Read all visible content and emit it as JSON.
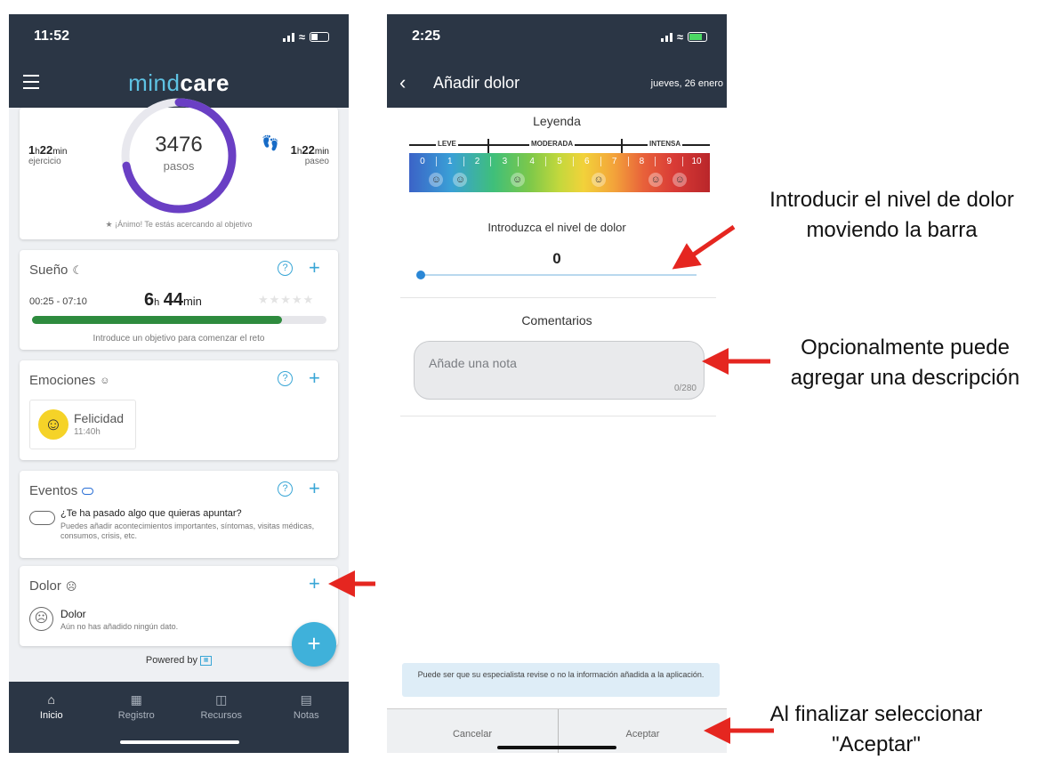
{
  "left": {
    "status_time": "11:52",
    "logo_thin": "mind",
    "logo_bold": "care",
    "activity": {
      "exercise_h": "1",
      "exercise_m": "22",
      "exercise_label": "ejercicio",
      "steps": "3476",
      "steps_label": "pasos",
      "walk_h": "1",
      "walk_m": "22",
      "walk_label": "paseo",
      "h_unit": "h",
      "min_unit": "min",
      "motivation": "¡Ánimo! Te estás acercando al objetivo",
      "progress": 0.72
    },
    "sleep": {
      "title": "Sueño",
      "range": "00:25 - 07:10",
      "hours": "6",
      "minutes": "44",
      "h_unit": "h",
      "min_unit": "min",
      "goal_text": "Introduce un objetivo para comenzar el reto",
      "progress": 0.85
    },
    "emotions": {
      "title": "Emociones",
      "emotion": "Felicidad",
      "time": "11:40h"
    },
    "events": {
      "title": "Eventos",
      "question": "¿Te ha pasado algo que quieras apuntar?",
      "description": "Puedes añadir acontecimientos importantes, síntomas, visitas médicas, consumos, crisis, etc."
    },
    "pain": {
      "title": "Dolor",
      "item_title": "Dolor",
      "empty": "Aún no has añadido ningún dato."
    },
    "powered_by": "Powered by",
    "nav": [
      {
        "label": "Inicio",
        "icon": "home-icon"
      },
      {
        "label": "Registro",
        "icon": "calendar-icon"
      },
      {
        "label": "Recursos",
        "icon": "book-icon"
      },
      {
        "label": "Notas",
        "icon": "document-icon"
      }
    ]
  },
  "right": {
    "status_time": "2:25",
    "title": "Añadir dolor",
    "date": "jueves, 26 enero",
    "legend_title": "Leyenda",
    "legend_labels": [
      "LEVE",
      "MODERADA",
      "INTENSA"
    ],
    "legend_numbers": [
      "0",
      "1",
      "2",
      "3",
      "4",
      "5",
      "6",
      "7",
      "8",
      "9",
      "10"
    ],
    "level_label": "Introduzca el nivel de dolor",
    "level_value": "0",
    "comments_label": "Comentarios",
    "note_placeholder": "Añade una nota",
    "char_count": "0/280",
    "notice": "Puede ser que su especialista revise o no la información añadida a la aplicación.",
    "cancel": "Cancelar",
    "accept": "Aceptar"
  },
  "annotations": {
    "a1_line1": "Introducir el nivel de dolor",
    "a1_line2": "moviendo la barra",
    "a2_line1": "Opcionalmente puede",
    "a2_line2": "agregar una descripción",
    "a3_line1": "Al finalizar seleccionar",
    "a3_line2": "\"Aceptar\""
  },
  "colors": {
    "header": "#2b3645",
    "accent": "#39a6d6",
    "progress_purple": "#6a3fc4",
    "sleep_green": "#2e8b3e",
    "arrow_red": "#e52620"
  }
}
